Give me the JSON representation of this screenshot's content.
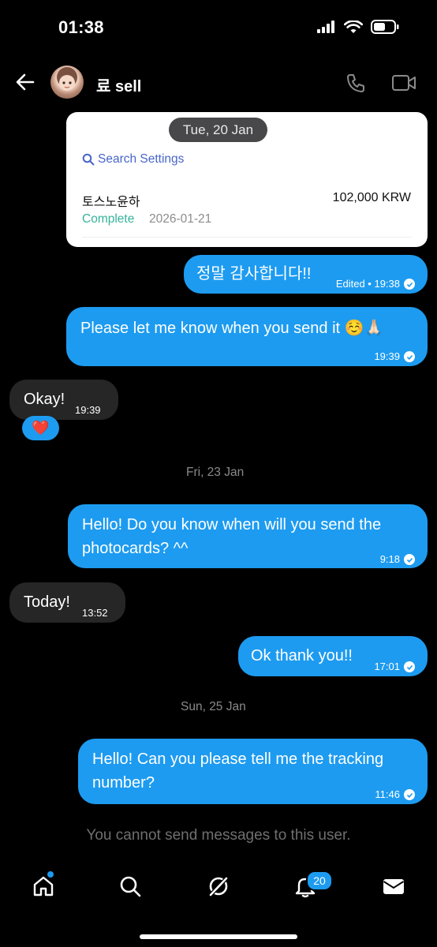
{
  "status_bar": {
    "time": "01:38"
  },
  "header": {
    "contact_name": "료 sell"
  },
  "transaction_card": {
    "date": "Tue, 20 Jan",
    "search_label": "Search Settings",
    "recipient": "토스노윤하",
    "amount": "102,000 KRW",
    "status": "Complete",
    "date_value": "2026-01-21"
  },
  "messages": [
    {
      "text": "정말 감사합니다!!",
      "meta": "Edited • 19:38"
    },
    {
      "text": "Please let me know when you send it ☺️🙏🏻",
      "meta": "19:39"
    },
    {
      "text": "Okay!",
      "meta": "19:39",
      "reaction": "❤️"
    },
    {
      "text": "Hello! Do you know when will you send the photocards? ^^",
      "meta": "9:18"
    },
    {
      "text": "Today!",
      "meta": "13:52"
    },
    {
      "text": "Ok thank you!!",
      "meta": "17:01"
    },
    {
      "text": "Hello! Can you please tell me the tracking number?",
      "meta": "11:46"
    }
  ],
  "day_separators": [
    "Fri, 23 Jan",
    "Sun, 25 Jan"
  ],
  "notice": "You cannot send messages to this user.",
  "tab_bar": {
    "notifications_badge": "20"
  },
  "colors": {
    "accent": "#1d9bf0",
    "incoming_bubble": "#262626",
    "complete_green": "#35b39a"
  }
}
